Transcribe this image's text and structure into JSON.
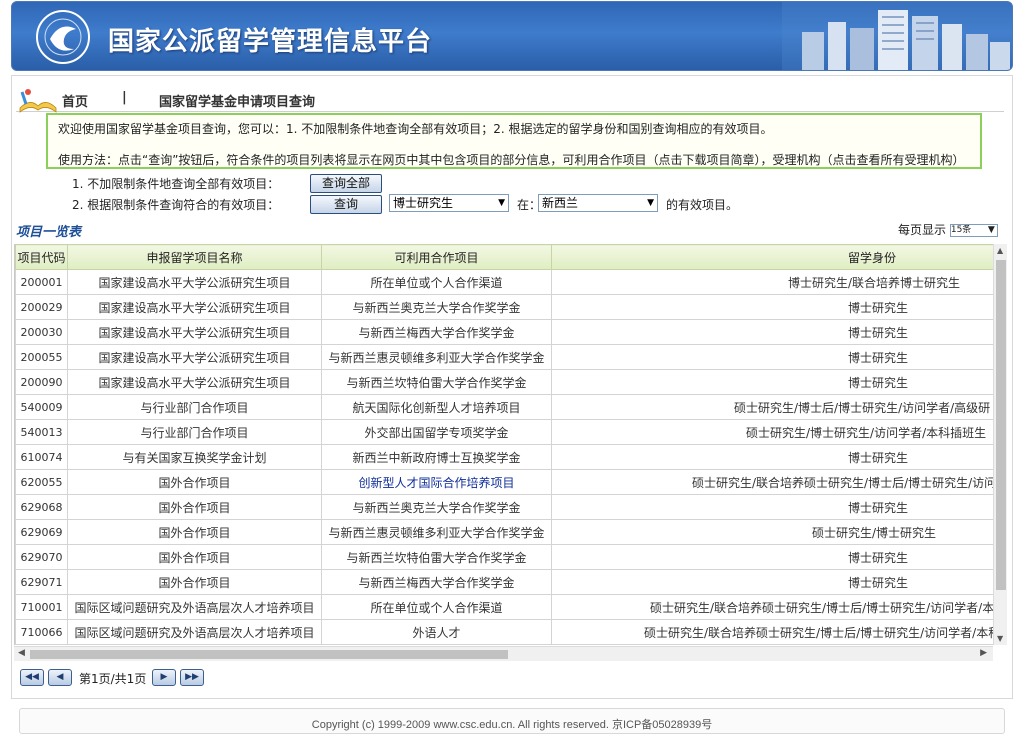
{
  "banner": {
    "title": "国家公派留学管理信息平台"
  },
  "breadcrumb": {
    "home": "首页",
    "separator": "|",
    "current": "国家留学基金申请项目查询"
  },
  "notice": {
    "line1": "欢迎使用国家留学基金项目查询，您可以：1. 不加限制条件地查询全部有效项目；2. 根据选定的留学身份和国别查询相应的有效项目。",
    "line2": "使用方法：点击“查询”按钮后，符合条件的项目列表将显示在网页中其中包含项目的部分信息，可利用合作项目（点击下载项目简章），受理机构（点击查看所有受理机构）"
  },
  "query": {
    "option1_label": "1. 不加限制条件地查询全部有效项目：",
    "query_all_button": "查询全部",
    "option2_label": "2. 根据限制条件查询符合的有效项目：",
    "query_button": "查询",
    "identity_select": "博士研究生",
    "in_label": "在：",
    "country_select": "新西兰",
    "suffix": "的有效项目。"
  },
  "list": {
    "heading": "项目一览表",
    "per_page_label": "每页显示",
    "per_page_value": "15条"
  },
  "table": {
    "headers": [
      "项目代码",
      "申报留学项目名称",
      "可利用合作项目",
      "留学身份"
    ],
    "rows": [
      [
        "200001",
        "国家建设高水平大学公派研究生项目",
        "所在单位或个人合作渠道",
        "博士研究生/联合培养博士研究生"
      ],
      [
        "200029",
        "国家建设高水平大学公派研究生项目",
        "与新西兰奥克兰大学合作奖学金",
        "博士研究生"
      ],
      [
        "200030",
        "国家建设高水平大学公派研究生项目",
        "与新西兰梅西大学合作奖学金",
        "博士研究生"
      ],
      [
        "200055",
        "国家建设高水平大学公派研究生项目",
        "与新西兰惠灵顿维多利亚大学合作奖学金",
        "博士研究生"
      ],
      [
        "200090",
        "国家建设高水平大学公派研究生项目",
        "与新西兰坎特伯雷大学合作奖学金",
        "博士研究生"
      ],
      [
        "540009",
        "与行业部门合作项目",
        "航天国际化创新型人才培养项目",
        "硕士研究生/博士后/博士研究生/访问学者/高级研"
      ],
      [
        "540013",
        "与行业部门合作项目",
        "外交部出国留学专项奖学金",
        "硕士研究生/博士研究生/访问学者/本科插班生"
      ],
      [
        "610074",
        "与有关国家互换奖学金计划",
        "新西兰中新政府博士互换奖学金",
        "博士研究生"
      ],
      [
        "620055",
        "国外合作项目",
        "创新型人才国际合作培养项目",
        "硕士研究生/联合培养硕士研究生/博士后/博士研究生/访问学者/"
      ],
      [
        "629068",
        "国外合作项目",
        "与新西兰奥克兰大学合作奖学金",
        "博士研究生"
      ],
      [
        "629069",
        "国外合作项目",
        "与新西兰惠灵顿维多利亚大学合作奖学金",
        "硕士研究生/博士研究生"
      ],
      [
        "629070",
        "国外合作项目",
        "与新西兰坎特伯雷大学合作奖学金",
        "博士研究生"
      ],
      [
        "629071",
        "国外合作项目",
        "与新西兰梅西大学合作奖学金",
        "博士研究生"
      ],
      [
        "710001",
        "国际区域问题研究及外语高层次人才培养项目",
        "所在单位或个人合作渠道",
        "硕士研究生/联合培养硕士研究生/博士后/博士研究生/访问学者/本科插班生/联"
      ],
      [
        "710066",
        "国际区域问题研究及外语高层次人才培养项目",
        "外语人才",
        "硕士研究生/联合培养硕士研究生/博士后/博士研究生/访问学者/本科插班生/联合"
      ]
    ]
  },
  "pagination": {
    "first": "◀◀",
    "prev": "◀",
    "info": "第1页/共1页",
    "next": "▶",
    "last": "▶▶"
  },
  "footer": {
    "text": "Copyright (c) 1999-2009 www.csc.edu.cn.  All rights reserved.   京ICP备05028939号"
  },
  "colors": {
    "banner": "#3470c0",
    "notice_border": "#8ad05a",
    "header_bg": "#dfeec2",
    "link": "#0f2d9a",
    "heading": "#1e4f97"
  },
  "icons": [
    "csc-logo-icon",
    "city-buildings-icon",
    "open-book-icon",
    "chevron-down-icon",
    "first-page-icon",
    "prev-page-icon",
    "next-page-icon",
    "last-page-icon"
  ]
}
